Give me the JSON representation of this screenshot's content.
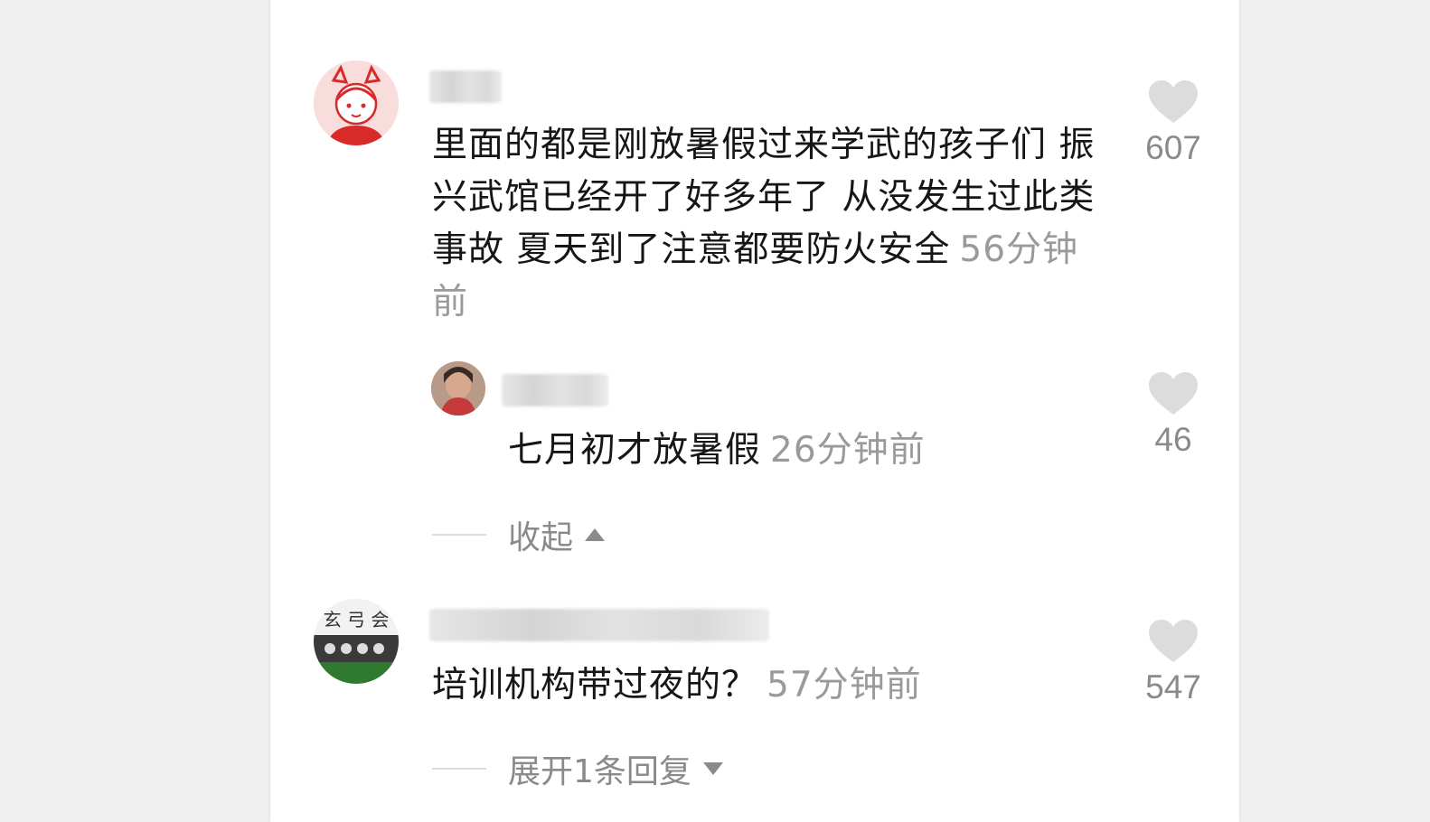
{
  "comments": [
    {
      "text": "里面的都是刚放暑假过来学武的孩子们 振兴武馆已经开了好多年了 从没发生过此类事故 夏天到了注意都要防火安全",
      "time": "56分钟前",
      "likes": "607",
      "replies": [
        {
          "text": "七月初才放暑假",
          "time": "26分钟前",
          "likes": "46"
        }
      ],
      "toggle_label": "收起"
    },
    {
      "text": "培训机构带过夜的？",
      "time": "57分钟前",
      "likes": "547",
      "toggle_label": "展开1条回复"
    }
  ],
  "icons": {
    "like": "heart-icon",
    "collapse": "caret-up-icon",
    "expand": "caret-down-icon"
  },
  "colors": {
    "text": "#161616",
    "meta": "#9a9a9a",
    "heart": "#dcdcdc"
  }
}
